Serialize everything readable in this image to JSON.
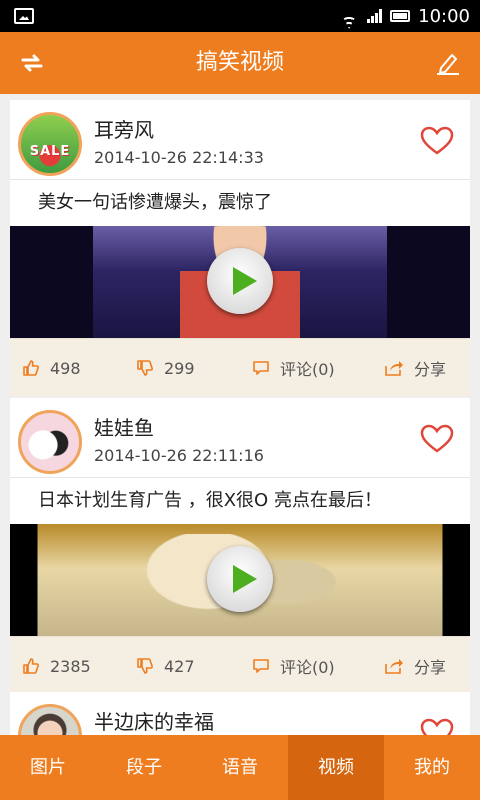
{
  "status_bar": {
    "time": "10:00"
  },
  "header": {
    "title": "搞笑视频"
  },
  "posts": [
    {
      "user": "耳旁风",
      "time": "2014-10-26 22:14:33",
      "text": "美女一句话惨遭爆头，震惊了",
      "likes": "498",
      "dislikes": "299",
      "comment_label": "评论(0)",
      "share_label": "分享",
      "avatar_text": "SALE"
    },
    {
      "user": "娃娃鱼",
      "time": "2014-10-26 22:11:16",
      "text": "日本计划生育广告 ，很X很O 亮点在最后！",
      "likes": "2385",
      "dislikes": "427",
      "comment_label": "评论(0)",
      "share_label": "分享"
    },
    {
      "user": "半边床的幸福"
    }
  ],
  "nav": {
    "items": [
      "图片",
      "段子",
      "语音",
      "视频",
      "我的"
    ],
    "active": "视频"
  },
  "colors": {
    "accent": "#ee7d1f",
    "accent_dark": "#d5660f",
    "action_bar": "#f5eee2"
  }
}
